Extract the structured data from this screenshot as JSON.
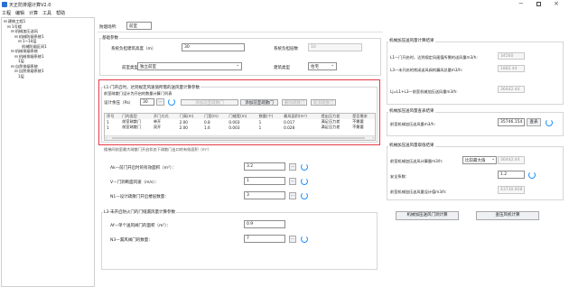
{
  "window": {
    "title": "天正防排烟计算V2.0"
  },
  "menu": [
    "工程",
    "编辑",
    "计算",
    "工具",
    "帮助"
  ],
  "tree": [
    {
      "label": "⊟ 建筑工程1",
      "indent": 0
    },
    {
      "label": "⊟ 1号楼",
      "indent": 1
    },
    {
      "label": "⊟ 机械加压送风",
      "indent": 2
    },
    {
      "label": "⊟ 机械防烟系统1",
      "indent": 3
    },
    {
      "label": "⊟ 1~10层",
      "indent": 4
    },
    {
      "label": "机械防烟区间1",
      "indent": 5
    },
    {
      "label": "⊟ 机械排烟系统",
      "indent": 2
    },
    {
      "label": "⊟ 机械排烟系统1",
      "indent": 3
    },
    {
      "label": "1层",
      "indent": 4
    },
    {
      "label": "⊟ 自然排烟系统",
      "indent": 2
    },
    {
      "label": "⊟ 自然排烟系统1",
      "indent": 3
    },
    {
      "label": "1层",
      "indent": 4
    }
  ],
  "header": {
    "location_label": "防烟场所:",
    "location_value": "前室"
  },
  "basic": {
    "group_title": "基础参数",
    "height_label": "系统负担建筑高度（m）",
    "height_value": "30",
    "zones_label": "系统负担层数",
    "zones_value": "10",
    "room_type_label": "前室类型",
    "room_type_value": "独立前室",
    "building_type_label": "建筑类型",
    "building_type_value": "住宅"
  },
  "l1": {
    "group_title": "L1-门开启时，达到规定风速值所需的送风量计算参数",
    "sub_label": "前室疏散门设计为开启的数量计算门列表",
    "pressure_label": "设计余压（Pa）",
    "pressure_value": "30",
    "pick_button": "...",
    "btn_add_single": "添加前室疏散门",
    "btn_add_double": "添加前室疏散门",
    "btn_delete": "删除疏散门",
    "btn_cancel": "取消疏散门",
    "columns": [
      "序号",
      "门的类型",
      "开门方式",
      "门高(m)",
      "门宽(m)",
      "门缝宽(m)",
      "数量(个)",
      "最风面积(m²)",
      "提出压力差",
      "是否需求"
    ],
    "rows": [
      [
        "1",
        "前室疏散门",
        "单开",
        "2.00",
        "0.8",
        "0.003",
        "1",
        "0.017",
        "满足压力差",
        "不需要"
      ],
      [
        "1",
        "前室疏散门",
        "双开",
        "2.00",
        "1.6",
        "0.003",
        "1",
        "0.028",
        "满足压力差",
        "不需要"
      ]
    ]
  },
  "l1_lower": {
    "hidden_label": "楼梯间前室最大疏散门开启状态下疏散门出口的有效面积（m²）",
    "ak_label": "Ak—前门开启时的有效面积（m²）：",
    "ak_value": "3.2",
    "v_label": "V—门洞断面风速（m/s）：",
    "v_value": "1",
    "n1_label": "N1—设计疏散门开启楼层数量：",
    "n1_value": "3"
  },
  "l3": {
    "group_title": "L3-未开启防火门的门缝漏风量计算参数",
    "af_label": "Af—单个送风阀门的面积（m²）：",
    "af_value": "0.9",
    "n3_label": "N3—漏风阀门的数量：",
    "n3_value": "7"
  },
  "results": {
    "group_title": "机械加压送风量计算结果",
    "l1_label": "L1—门开启时，达到规定风速值所需的送风量m3/h:",
    "l1_value": "34560",
    "l3_label": "L3—未开启的常闭送风阀的漏风总量m3/h:",
    "l3_value": "1882.44",
    "lj_label": "Lj=L1+L3—前室机械加压送风量m3/h:",
    "lj_value": "36442.44"
  },
  "lookup": {
    "group_title": "机械加压送风量查表结果",
    "label": "前室机械加压送风量m3/h:",
    "value": "35746.154",
    "button": "查表"
  },
  "final": {
    "group_title": "机械加压送风量取值结果",
    "calc_label": "前室机械加压送风计算量m3/h:",
    "calc_select": "比较最大值",
    "calc_value": "36442.44",
    "safety_label": "安全系数:",
    "safety_value": "1.2",
    "design_label": "前室机械加压送风量设计值m3/h:",
    "design_value": "43730.928"
  },
  "actions": {
    "btn_calc": "机械加压送风门洞计算",
    "btn_fan": "查压风机计算"
  },
  "colors": {
    "highlight": "#e63946",
    "accent": "#1e90ff"
  }
}
